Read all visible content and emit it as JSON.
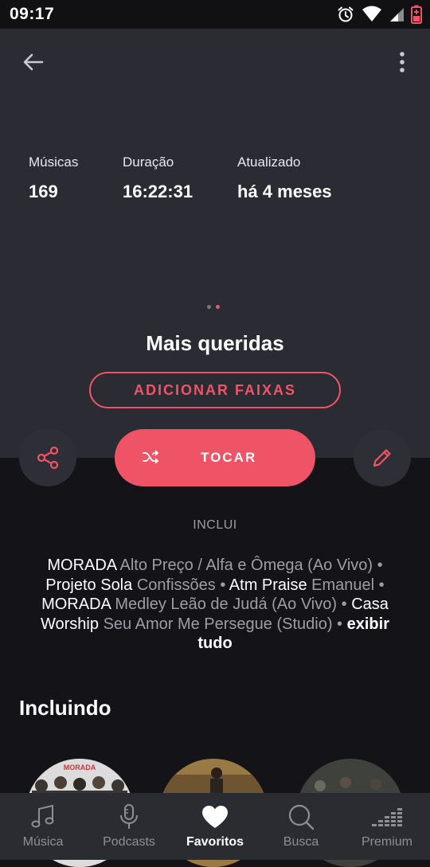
{
  "status_bar": {
    "time": "09:17"
  },
  "stats": [
    {
      "label": "Músicas",
      "value": "169"
    },
    {
      "label": "Duração",
      "value": "16:22:31"
    },
    {
      "label": "Atualizado",
      "value": "há 4 meses"
    }
  ],
  "playlist": {
    "title": "Mais queridas",
    "add_tracks_label": "ADICIONAR FAIXAS",
    "play_label": "TOCAR"
  },
  "includes": {
    "label": "INCLUI",
    "items": [
      {
        "artist": "MORADA",
        "track": "Alto Preço / Alfa e Ômega (Ao Vivo)"
      },
      {
        "artist": "Projeto Sola",
        "track": "Confissões"
      },
      {
        "artist": "Atm Praise",
        "track": "Emanuel"
      },
      {
        "artist": "MORADA",
        "track": "Medley Leão de Judá (Ao Vivo)"
      },
      {
        "artist": "Casa Worship",
        "track": "Seu Amor Me Persegue (Studio)"
      }
    ],
    "separator": "•",
    "show_all": "exibir tudo"
  },
  "section": {
    "title": "Incluindo"
  },
  "covers": [
    {
      "label": "MORADA"
    }
  ],
  "bottom_nav": [
    {
      "label": "Música",
      "icon": "music-note-icon",
      "active": false
    },
    {
      "label": "Podcasts",
      "icon": "microphone-icon",
      "active": false
    },
    {
      "label": "Favoritos",
      "icon": "heart-icon",
      "active": true
    },
    {
      "label": "Busca",
      "icon": "search-icon",
      "active": false
    },
    {
      "label": "Premium",
      "icon": "equalizer-icon",
      "active": false
    }
  ],
  "colors": {
    "accent": "#ef5466",
    "hero_background": "#2b2b34",
    "page_background": "#141418",
    "nav_background": "#2b2b32"
  }
}
